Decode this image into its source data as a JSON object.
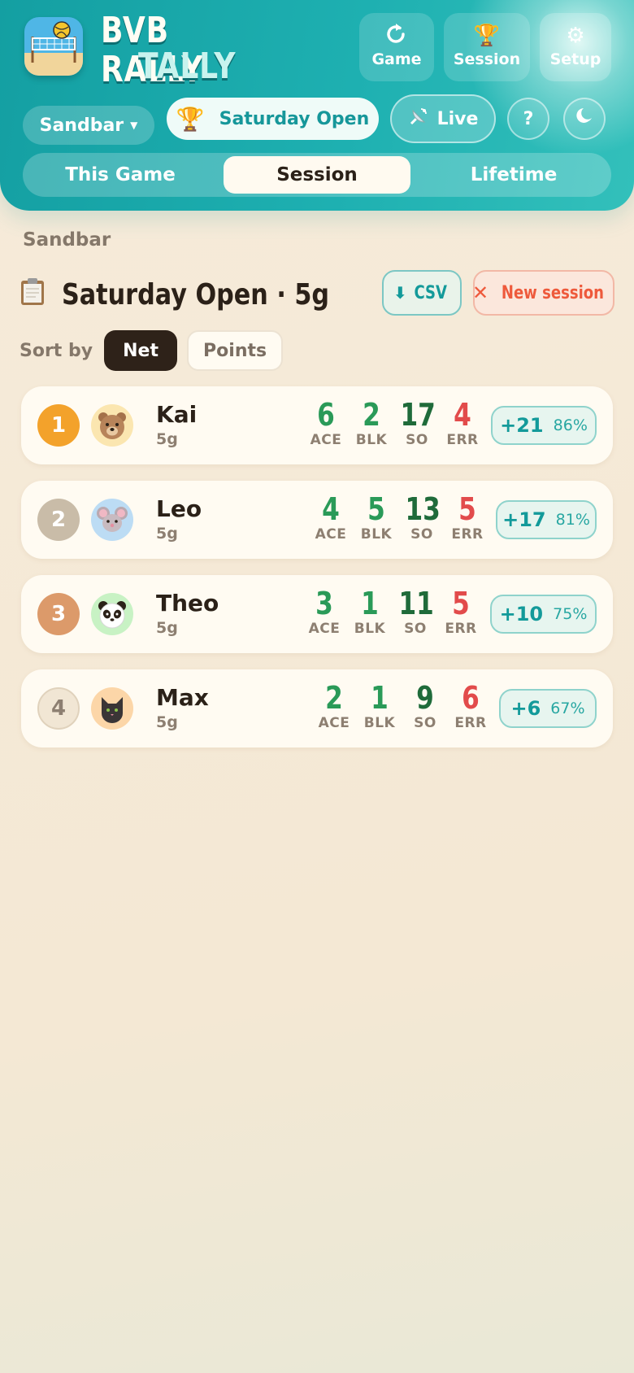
{
  "app": {
    "name_line1": "BVB RALLY",
    "name_line2": "TALLY"
  },
  "header": {
    "game_label": "Game",
    "session_label": "Session",
    "setup_label": "Setup",
    "group": "Sandbar",
    "session_name": "Saturday Open",
    "live_label": "Live",
    "help_label": "?"
  },
  "tabs": [
    {
      "label": "This Game"
    },
    {
      "label": "Session",
      "active": true
    },
    {
      "label": "Lifetime"
    }
  ],
  "content": {
    "group_label": "Sandbar",
    "title": "Saturday Open · 5g",
    "csv_label": "CSV",
    "new_session_label": "New session",
    "sort_by_label": "Sort by",
    "sort_net_label": "Net",
    "sort_points_label": "Points"
  },
  "stat_keys": {
    "ace": "ACE",
    "blk": "BLK",
    "so": "SO",
    "err": "ERR"
  },
  "players": [
    {
      "rank": "1",
      "name": "Kai",
      "games": "5g",
      "ace": "6",
      "blk": "2",
      "so": "17",
      "err": "4",
      "net": "+21",
      "pct": "86%",
      "avatar": "bear-icon"
    },
    {
      "rank": "2",
      "name": "Leo",
      "games": "5g",
      "ace": "4",
      "blk": "5",
      "so": "13",
      "err": "5",
      "net": "+17",
      "pct": "81%",
      "avatar": "mouse-icon"
    },
    {
      "rank": "3",
      "name": "Theo",
      "games": "5g",
      "ace": "3",
      "blk": "1",
      "so": "11",
      "err": "5",
      "net": "+10",
      "pct": "75%",
      "avatar": "panda-icon"
    },
    {
      "rank": "4",
      "name": "Max",
      "games": "5g",
      "ace": "2",
      "blk": "1",
      "so": "9",
      "err": "6",
      "net": "+6",
      "pct": "67%",
      "avatar": "cat-icon"
    }
  ],
  "colors": {
    "accent": "#1eb0b1",
    "ace": "#2a9a58",
    "blk": "#2a9a58",
    "so": "#1f6b3a",
    "err": "#e24b4b",
    "rank_gold": "#f3a22b",
    "rank_silver": "#c9bca8",
    "rank_bronze": "#dc9a6a"
  }
}
